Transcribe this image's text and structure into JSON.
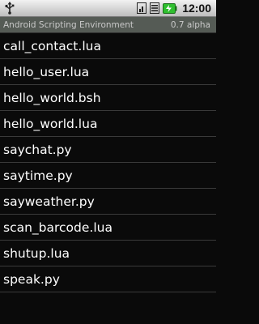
{
  "status_bar": {
    "time": "12:00",
    "icons": [
      "usb-icon",
      "signal-icon",
      "network-3g-icon",
      "battery-charging-icon"
    ]
  },
  "title_bar": {
    "title": "Android Scripting Environment",
    "version": "0.7 alpha"
  },
  "scripts": [
    {
      "name": "call_contact.lua"
    },
    {
      "name": "hello_user.lua"
    },
    {
      "name": "hello_world.bsh"
    },
    {
      "name": "hello_world.lua"
    },
    {
      "name": "saychat.py"
    },
    {
      "name": "saytime.py"
    },
    {
      "name": "sayweather.py"
    },
    {
      "name": "scan_barcode.lua"
    },
    {
      "name": "shutup.lua"
    },
    {
      "name": "speak.py"
    }
  ],
  "colors": {
    "background": "#0a0a0a",
    "title_bar": "#555b55",
    "divider": "#3a3a3a",
    "battery_green": "#2fbf2f"
  }
}
